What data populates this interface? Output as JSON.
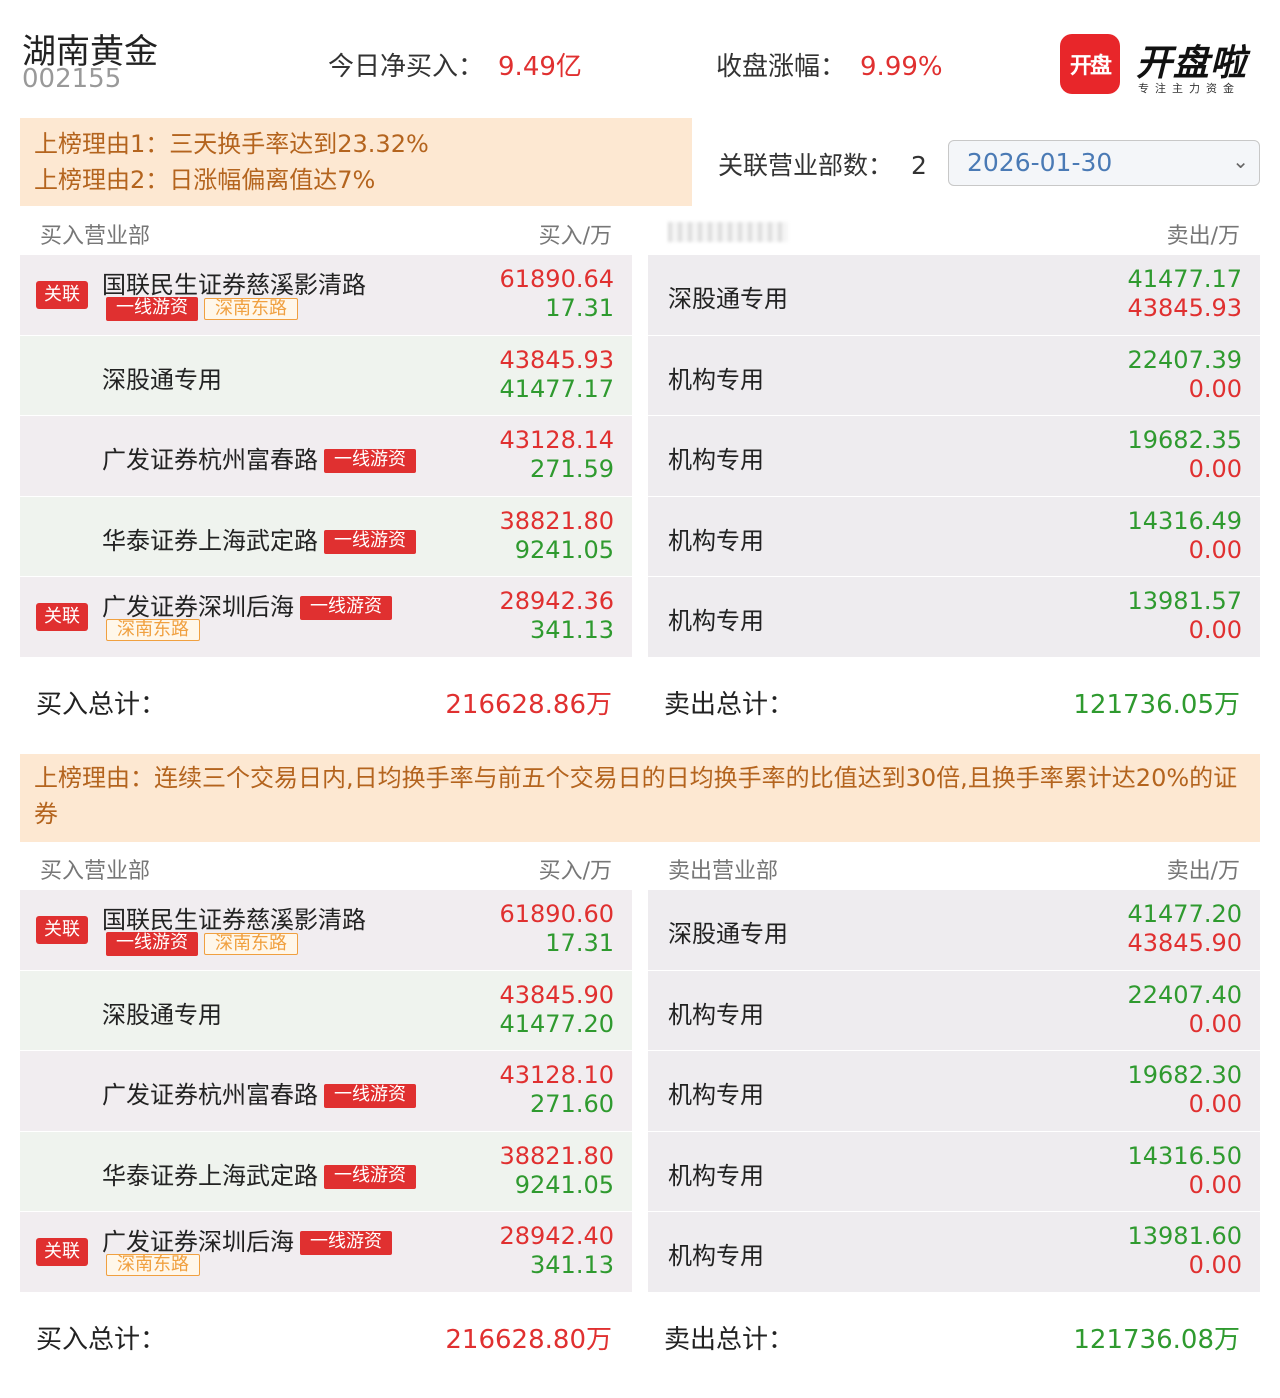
{
  "header": {
    "stock_name": "湖南黄金",
    "stock_code": "002155",
    "net_buy_label": "今日净买入：",
    "net_buy_value": "9.49亿",
    "change_label": "收盘涨幅：",
    "change_value": "9.99%"
  },
  "logo": {
    "box_text": "开盘",
    "text": "开盘啦",
    "subtitle": "专注主力资金"
  },
  "section1": {
    "reason_1": "上榜理由1：三天换手率达到23.32%",
    "reason_2": "上榜理由2：日涨幅偏离值达7%",
    "dept_count_label": "关联营业部数：",
    "dept_count_value": "2",
    "date_value": "2026-01-30",
    "buy_header": "买入营业部",
    "buy_unit": "买入/万",
    "sell_unit": "卖出/万",
    "buy_rows": [
      {
        "rel": "关联",
        "name": "国联民生证券慈溪影清路",
        "badge_red": "一线游资",
        "badge_orange": "深南东路",
        "v1": "61890.64",
        "v2": "17.31"
      },
      {
        "name": "深股通专用",
        "v1": "43845.93",
        "v2": "41477.17"
      },
      {
        "name": "广发证券杭州富春路",
        "badge_red": "一线游资",
        "v1": "43128.14",
        "v2": "271.59"
      },
      {
        "name": "华泰证券上海武定路",
        "badge_red": "一线游资",
        "v1": "38821.80",
        "v2": "9241.05"
      },
      {
        "rel": "关联",
        "name": "广发证券深圳后海",
        "badge_red": "一线游资",
        "badge_orange": "深南东路",
        "v1": "28942.36",
        "v2": "341.13"
      }
    ],
    "sell_rows": [
      {
        "name": "深股通专用",
        "v1": "41477.17",
        "v2": "43845.93"
      },
      {
        "name": "机构专用",
        "v1": "22407.39",
        "v2": "0.00"
      },
      {
        "name": "机构专用",
        "v1": "19682.35",
        "v2": "0.00"
      },
      {
        "name": "机构专用",
        "v1": "14316.49",
        "v2": "0.00"
      },
      {
        "name": "机构专用",
        "v1": "13981.57",
        "v2": "0.00"
      }
    ],
    "buy_total_label": "买入总计：",
    "buy_total": "216628.86万",
    "sell_total_label": "卖出总计：",
    "sell_total": "121736.05万"
  },
  "section2": {
    "reason": "上榜理由：连续三个交易日内,日均换手率与前五个交易日的日均换手率的比值达到30倍,且换手率累计达20%的证券",
    "buy_header": "买入营业部",
    "buy_unit": "买入/万",
    "sell_header": "卖出营业部",
    "sell_unit": "卖出/万",
    "buy_rows": [
      {
        "rel": "关联",
        "name": "国联民生证券慈溪影清路",
        "badge_red": "一线游资",
        "badge_orange": "深南东路",
        "v1": "61890.60",
        "v2": "17.31"
      },
      {
        "name": "深股通专用",
        "v1": "43845.90",
        "v2": "41477.20"
      },
      {
        "name": "广发证券杭州富春路",
        "badge_red": "一线游资",
        "v1": "43128.10",
        "v2": "271.60"
      },
      {
        "name": "华泰证券上海武定路",
        "badge_red": "一线游资",
        "v1": "38821.80",
        "v2": "9241.05"
      },
      {
        "rel": "关联",
        "name": "广发证券深圳后海",
        "badge_red": "一线游资",
        "badge_orange": "深南东路",
        "v1": "28942.40",
        "v2": "341.13"
      }
    ],
    "sell_rows": [
      {
        "name": "深股通专用",
        "v1": "41477.20",
        "v2": "43845.90"
      },
      {
        "name": "机构专用",
        "v1": "22407.40",
        "v2": "0.00"
      },
      {
        "name": "机构专用",
        "v1": "19682.30",
        "v2": "0.00"
      },
      {
        "name": "机构专用",
        "v1": "14316.50",
        "v2": "0.00"
      },
      {
        "name": "机构专用",
        "v1": "13981.60",
        "v2": "0.00"
      }
    ],
    "buy_total_label": "买入总计：",
    "buy_total": "216628.80万",
    "sell_total_label": "卖出总计：",
    "sell_total": "121736.08万"
  },
  "colors": {
    "red": "#e03030",
    "green": "#2f9a2f",
    "reason_bg": "#fde8d2",
    "reason_text": "#b4641e"
  }
}
